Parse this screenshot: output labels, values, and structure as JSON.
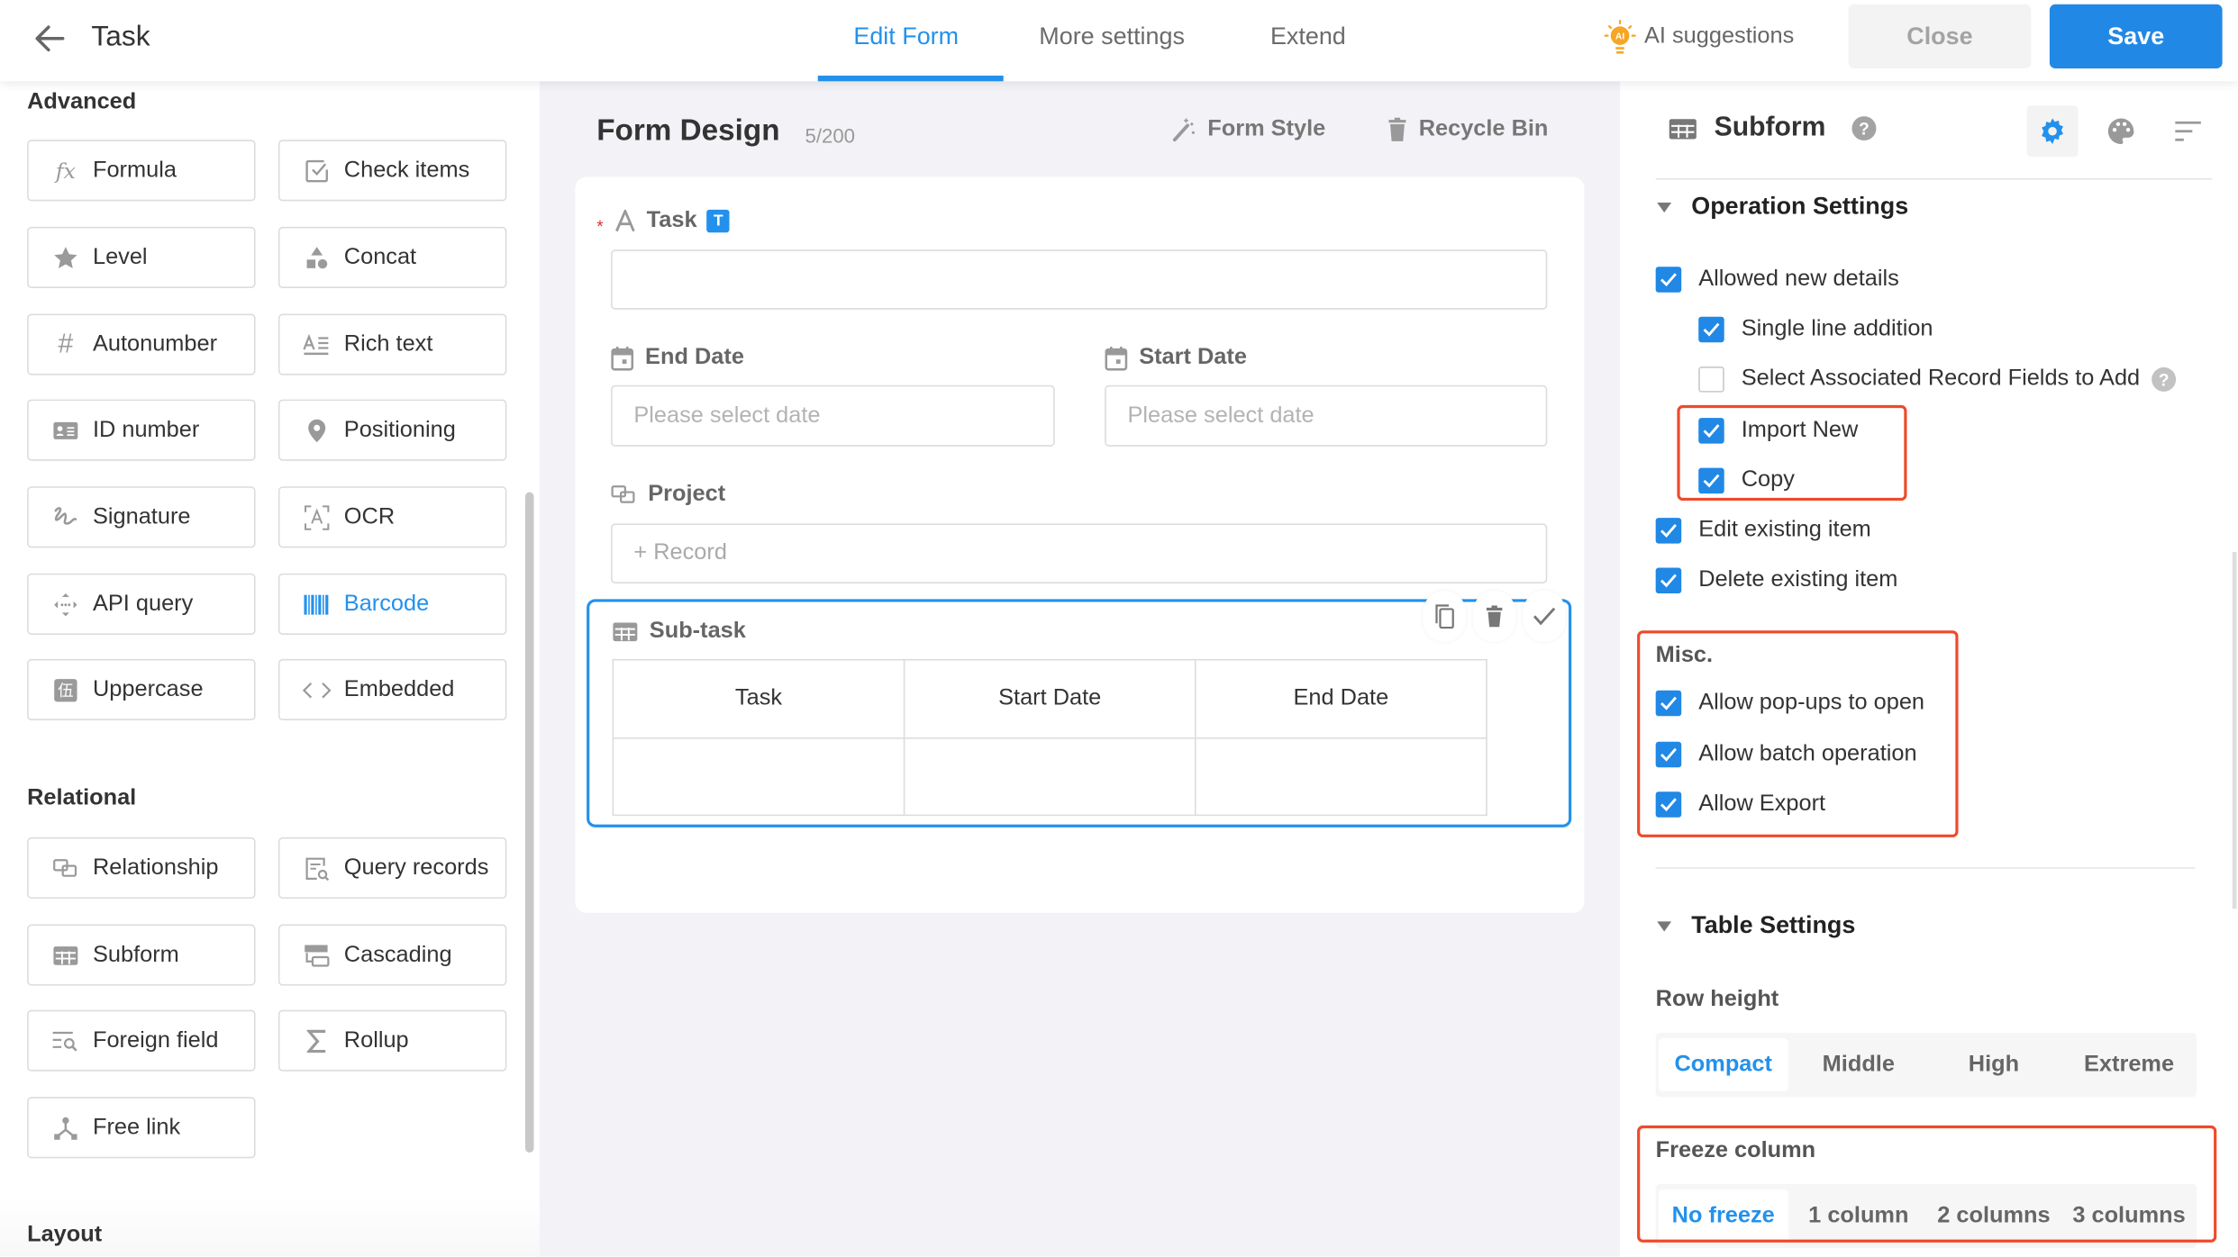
{
  "header": {
    "back_icon": "arrow-left-icon",
    "title": "Task",
    "tabs": [
      {
        "label": "Edit Form",
        "active": true
      },
      {
        "label": "More settings",
        "active": false
      },
      {
        "label": "Extend",
        "active": false
      }
    ],
    "ai_suggestions": {
      "label": "AI suggestions",
      "icon": "ai-lightbulb-icon",
      "badge": "AI"
    },
    "close_label": "Close",
    "save_label": "Save"
  },
  "colors": {
    "accent": "#2391ec",
    "save_button": "#2188e6",
    "highlight_border": "#ee4a2a",
    "canvas_bg": "#f3f3f7",
    "required": "#e02f2f",
    "ai_icon": "#f5a623"
  },
  "sidebar": {
    "sections": [
      {
        "title": "Advanced",
        "items": [
          {
            "label": "Formula",
            "icon": "fx-icon"
          },
          {
            "label": "Check items",
            "icon": "checkbox-icon"
          },
          {
            "label": "Level",
            "icon": "star-icon"
          },
          {
            "label": "Concat",
            "icon": "shapes-icon"
          },
          {
            "label": "Autonumber",
            "icon": "hash-icon"
          },
          {
            "label": "Rich text",
            "icon": "rich-text-icon"
          },
          {
            "label": "ID number",
            "icon": "id-card-icon"
          },
          {
            "label": "Positioning",
            "icon": "location-pin-icon"
          },
          {
            "label": "Signature",
            "icon": "signature-icon"
          },
          {
            "label": "OCR",
            "icon": "ocr-scan-icon"
          },
          {
            "label": "API query",
            "icon": "api-icon"
          },
          {
            "label": "Barcode",
            "icon": "barcode-icon",
            "active": true
          },
          {
            "label": "Uppercase",
            "icon": "uppercase-icon",
            "glyph": "伍"
          },
          {
            "label": "Embedded",
            "icon": "code-icon"
          }
        ]
      },
      {
        "title": "Relational",
        "items": [
          {
            "label": "Relationship",
            "icon": "relationship-icon"
          },
          {
            "label": "Query records",
            "icon": "query-records-icon"
          },
          {
            "label": "Subform",
            "icon": "table-grid-icon"
          },
          {
            "label": "Cascading",
            "icon": "cascading-icon"
          },
          {
            "label": "Foreign field",
            "icon": "foreign-field-icon"
          },
          {
            "label": "Rollup",
            "icon": "sigma-icon"
          },
          {
            "label": "Free link",
            "icon": "free-link-icon"
          }
        ]
      },
      {
        "title": "Layout",
        "items": []
      }
    ]
  },
  "canvas": {
    "title": "Form Design",
    "count": "5/200",
    "form_style_label": "Form Style",
    "recycle_bin_label": "Recycle Bin",
    "fields": {
      "task": {
        "label": "Task",
        "required_mark": "*",
        "badge": "T",
        "value": ""
      },
      "end_date": {
        "label": "End Date",
        "placeholder": "Please select date"
      },
      "start_date": {
        "label": "Start Date",
        "placeholder": "Please select date"
      },
      "project": {
        "label": "Project",
        "placeholder": "+ Record"
      },
      "subtask": {
        "label": "Sub-task",
        "columns": [
          "Task",
          "Start Date",
          "End Date"
        ],
        "rows": [
          [
            "",
            "",
            ""
          ]
        ],
        "actions": [
          "copy-icon",
          "delete-icon",
          "check-icon"
        ]
      }
    }
  },
  "properties": {
    "title": "Subform",
    "tabs": [
      {
        "icon": "gear-icon",
        "selected": true
      },
      {
        "icon": "palette-icon",
        "selected": false
      },
      {
        "icon": "sort-icon",
        "selected": false
      }
    ],
    "operation_settings": {
      "title": "Operation Settings",
      "options": [
        {
          "label": "Allowed new details",
          "checked": true,
          "level": 0
        },
        {
          "label": "Single line addition",
          "checked": true,
          "level": 1
        },
        {
          "label": "Select Associated Record Fields to Add",
          "checked": false,
          "level": 1,
          "help": true
        },
        {
          "label": "Import New",
          "checked": true,
          "level": 1
        },
        {
          "label": "Copy",
          "checked": true,
          "level": 1
        },
        {
          "label": "Edit existing item",
          "checked": true,
          "level": 0
        },
        {
          "label": "Delete existing item",
          "checked": true,
          "level": 0
        }
      ]
    },
    "misc": {
      "title": "Misc.",
      "options": [
        {
          "label": "Allow pop-ups to open",
          "checked": true
        },
        {
          "label": "Allow batch operation",
          "checked": true
        },
        {
          "label": "Allow Export",
          "checked": true
        }
      ]
    },
    "table_settings": {
      "title": "Table Settings",
      "row_height": {
        "label": "Row height",
        "options": [
          "Compact",
          "Middle",
          "High",
          "Extreme"
        ],
        "selected": "Compact"
      },
      "freeze_column": {
        "label": "Freeze column",
        "options": [
          "No freeze",
          "1 column",
          "2 columns",
          "3 columns"
        ],
        "selected": "No freeze"
      }
    }
  }
}
